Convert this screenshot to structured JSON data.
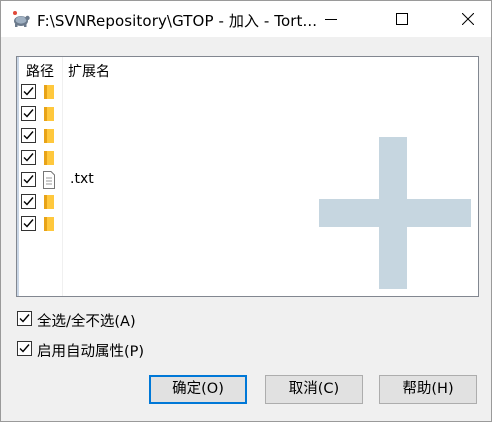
{
  "window": {
    "title": "F:\\SVNRepository\\GTOP - 加入 - Tort...",
    "controls": {
      "minimize": "minimize",
      "maximize": "maximize",
      "close": "close"
    }
  },
  "list": {
    "columns": {
      "path": "路径",
      "extension": "扩展名"
    },
    "rows": [
      {
        "icon": "folder-icon",
        "checked": true,
        "ext": ""
      },
      {
        "icon": "folder-icon",
        "checked": true,
        "ext": ""
      },
      {
        "icon": "folder-icon",
        "checked": true,
        "ext": ""
      },
      {
        "icon": "folder-icon",
        "checked": true,
        "ext": ""
      },
      {
        "icon": "file-icon",
        "checked": true,
        "ext": ".txt"
      },
      {
        "icon": "folder-icon",
        "checked": true,
        "ext": ""
      },
      {
        "icon": "folder-icon",
        "checked": true,
        "ext": ""
      }
    ],
    "watermark": "add-plus-icon"
  },
  "options": {
    "select_all": {
      "label": "全选/全不选(A)",
      "checked": true
    },
    "auto_props": {
      "label": "启用自动属性(P)",
      "checked": true
    }
  },
  "buttons": {
    "ok": "确定(O)",
    "cancel": "取消(C)",
    "help": "帮助(H)"
  },
  "colors": {
    "accent": "#0078d7",
    "folder": "#ffc83d",
    "watermark": "#c6d6e0"
  }
}
